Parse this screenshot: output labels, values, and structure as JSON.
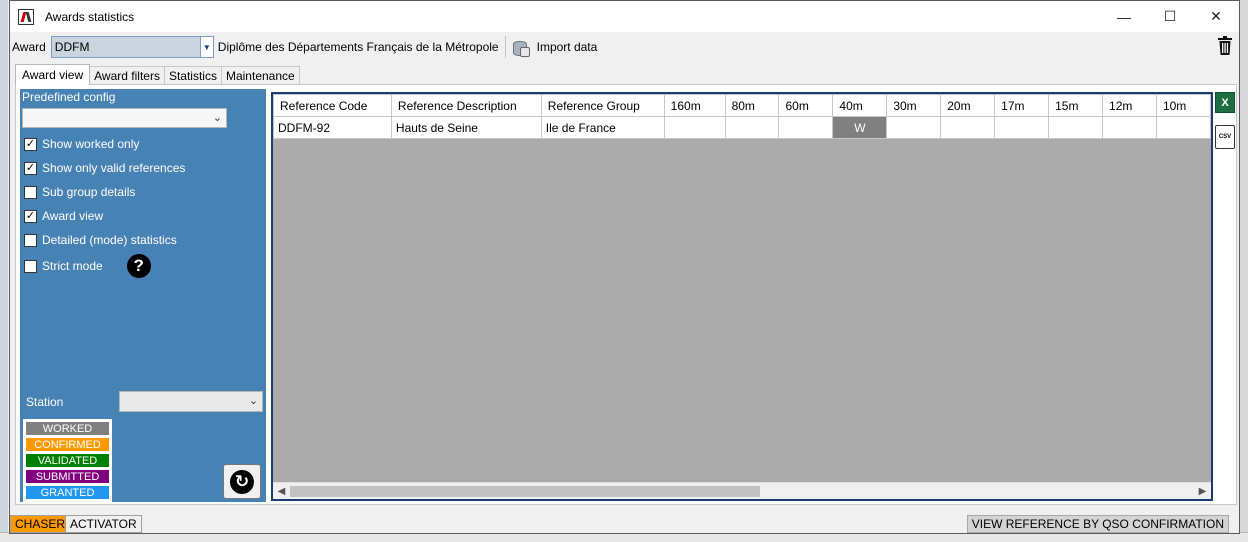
{
  "window": {
    "title": "Awards statistics",
    "controls": [
      "—",
      "☐",
      "✕"
    ]
  },
  "toolbar": {
    "award_label": "Award",
    "award_value": "DDFM",
    "award_description": "Diplôme des Départements Français de la Métropole",
    "import_label": "Import data"
  },
  "tabs": [
    {
      "label": "Award view",
      "active": true
    },
    {
      "label": "Award filters",
      "active": false
    },
    {
      "label": "Statistics",
      "active": false
    },
    {
      "label": "Maintenance",
      "active": false
    }
  ],
  "left_panel": {
    "predefined_label": "Predefined config",
    "predefined_value": "",
    "options": [
      {
        "label": "Show worked only",
        "checked": true
      },
      {
        "label": "Show only valid references",
        "checked": true
      },
      {
        "label": "Sub group details",
        "checked": false
      },
      {
        "label": "Award view",
        "checked": true
      },
      {
        "label": "Detailed (mode) statistics",
        "checked": false
      },
      {
        "label": "Strict mode",
        "checked": false
      }
    ],
    "help_glyph": "?",
    "station_label": "Station",
    "station_value": "",
    "legend": [
      {
        "label": "WORKED",
        "color": "#808080"
      },
      {
        "label": "CONFIRMED",
        "color": "#ff9900"
      },
      {
        "label": "VALIDATED",
        "color": "#008000"
      },
      {
        "label": "SUBMITTED",
        "color": "#800080"
      },
      {
        "label": "GRANTED",
        "color": "#2196f3"
      }
    ]
  },
  "grid": {
    "columns": [
      "Reference Code",
      "Reference Description",
      "Reference Group",
      "160m",
      "80m",
      "60m",
      "40m",
      "30m",
      "20m",
      "17m",
      "15m",
      "12m",
      "10m"
    ],
    "rows": [
      [
        "DDFM-92",
        "Hauts de Seine",
        "Ile de France",
        "",
        "",
        "",
        "W",
        "",
        "",
        "",
        "",
        "",
        ""
      ]
    ]
  },
  "side_icons": {
    "excel": "X",
    "csv": "CSV"
  },
  "status": {
    "chaser_label": "CHASER",
    "activator_label": "ACTIVATOR",
    "view_reference_label": "VIEW REFERENCE BY QSO CONFIRMATION",
    "chaser_color": "#ff9900"
  }
}
